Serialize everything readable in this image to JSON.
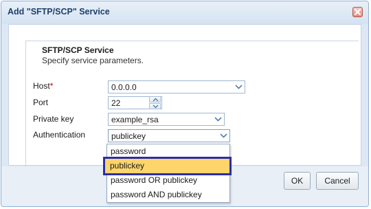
{
  "dialog": {
    "title": "Add \"SFTP/SCP\" Service",
    "section_title": "SFTP/SCP Service",
    "section_desc": "Specify service parameters."
  },
  "form": {
    "host": {
      "label": "Host",
      "required_mark": "*",
      "value": "0.0.0.0"
    },
    "port": {
      "label": "Port",
      "value": "22"
    },
    "private_key": {
      "label": "Private key",
      "value": "example_rsa"
    },
    "authentication": {
      "label": "Authentication",
      "value": "publickey",
      "options": [
        "password",
        "publickey",
        "password OR publickey",
        "password AND publickey"
      ],
      "highlighted": "publickey"
    }
  },
  "buttons": {
    "ok": "OK",
    "cancel": "Cancel"
  },
  "icons": {
    "close": "close-icon",
    "dropdown": "chevron-down-icon",
    "spin_up": "chevron-up-icon",
    "spin_down": "chevron-down-icon"
  },
  "colors": {
    "accent": "#1c3f6b",
    "selection": "#fdd56b",
    "focus_border": "#2c2ea8",
    "required": "#c00000"
  }
}
